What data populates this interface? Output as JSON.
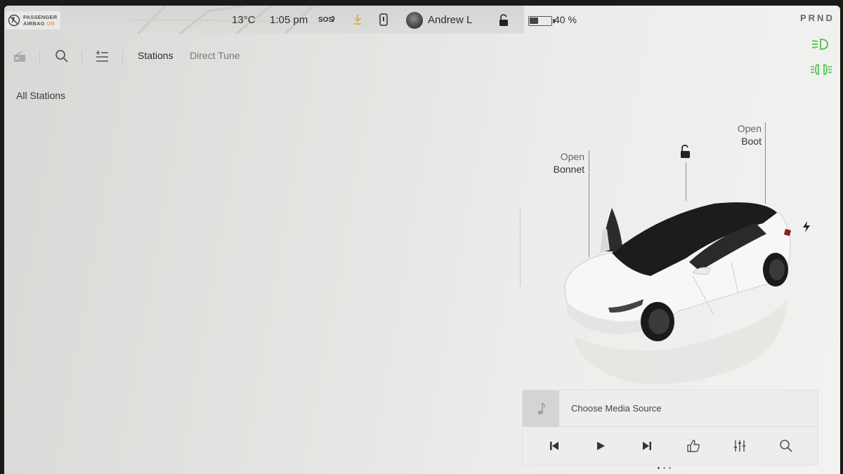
{
  "status_bar": {
    "airbag_line1": "PASSENGER",
    "airbag_line2": "AIRBAG",
    "airbag_state": "ON",
    "temperature": "13°C",
    "time": "1:05 pm",
    "sos_label": "SOS",
    "profile_name": "Andrew L",
    "battery_percent": "40 %",
    "battery_level": 0.4,
    "gear_indicator": "PRND"
  },
  "media_app": {
    "tabs": [
      {
        "label": "Stations",
        "active": true
      },
      {
        "label": "Direct Tune",
        "active": false
      }
    ],
    "section_title": "All Stations"
  },
  "car": {
    "bonnet_label_1": "Open",
    "bonnet_label_2": "Bonnet",
    "boot_label_1": "Open",
    "boot_label_2": "Boot"
  },
  "media_player": {
    "source_label": "Choose Media Source",
    "controls": [
      "previous-icon",
      "play-icon",
      "next-icon",
      "thumbs-up-icon",
      "equalizer-icon",
      "search-icon"
    ]
  },
  "colors": {
    "airbag_on": "#e8a23a",
    "light_indicator": "#4cc04c",
    "download_icon": "#e8a23a"
  }
}
